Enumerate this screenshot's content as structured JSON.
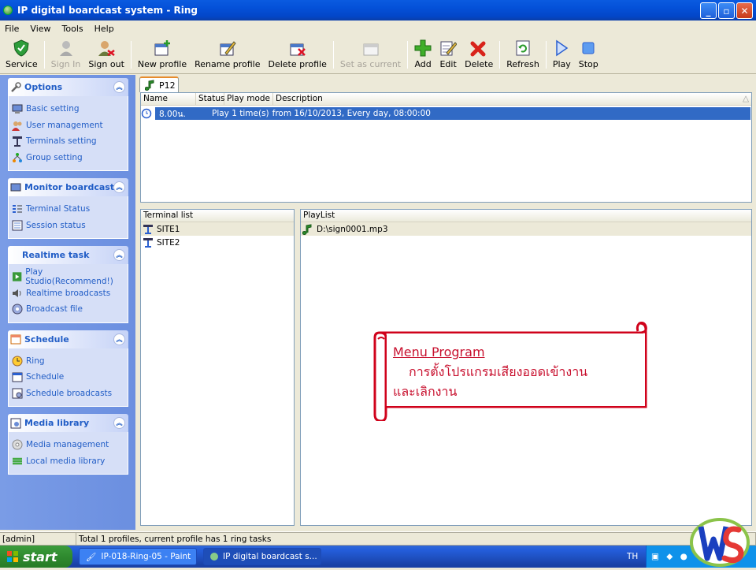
{
  "window": {
    "title": "IP digital boardcast system  -  Ring"
  },
  "menu": [
    "File",
    "View",
    "Tools",
    "Help"
  ],
  "toolbar": [
    {
      "label": "Service",
      "icon": "shield-icon",
      "disabled": false
    },
    {
      "label": "Sign In",
      "icon": "user-icon",
      "disabled": true
    },
    {
      "label": "Sign out",
      "icon": "user-signout-icon",
      "disabled": false
    },
    {
      "label": "New profile",
      "icon": "new-profile-icon",
      "disabled": false
    },
    {
      "label": "Rename profile",
      "icon": "rename-profile-icon",
      "disabled": false
    },
    {
      "label": "Delete profile",
      "icon": "delete-profile-icon",
      "disabled": false
    },
    {
      "label": "Set as current",
      "icon": "set-current-icon",
      "disabled": true
    },
    {
      "label": "Add",
      "icon": "add-icon",
      "disabled": false
    },
    {
      "label": "Edit",
      "icon": "edit-icon",
      "disabled": false
    },
    {
      "label": "Delete",
      "icon": "delete-icon",
      "disabled": false
    },
    {
      "label": "Refresh",
      "icon": "refresh-icon",
      "disabled": false
    },
    {
      "label": "Play",
      "icon": "play-icon",
      "disabled": false
    },
    {
      "label": "Stop",
      "icon": "stop-icon",
      "disabled": false
    }
  ],
  "sidebar": {
    "groups": [
      {
        "title": "Options",
        "items": [
          "Basic setting",
          "User management",
          "Terminals setting",
          "Group setting"
        ]
      },
      {
        "title": "Monitor boardcast",
        "items": [
          "Terminal Status",
          "Session status"
        ]
      },
      {
        "title": "Realtime task",
        "items": [
          "Play Studio(Recommend!)",
          "Realtime broadcasts",
          "Broadcast file"
        ]
      },
      {
        "title": "Schedule",
        "items": [
          "Ring",
          "Schedule",
          "Schedule broadcasts"
        ]
      },
      {
        "title": "Media library",
        "items": [
          "Media management",
          "Local media library"
        ]
      }
    ]
  },
  "tabs": [
    {
      "label": "P12"
    }
  ],
  "profiles_table": {
    "columns": [
      "Name",
      "Status",
      "Play mode",
      "Description"
    ],
    "rows": [
      {
        "name": "8.00น.",
        "status": "",
        "play_mode": "Play 1 time(s)",
        "description": "from 16/10/2013, Every day, 08:00:00"
      }
    ]
  },
  "terminal_list": {
    "header": "Terminal list",
    "items": [
      "SITE1",
      "SITE2"
    ]
  },
  "playlist": {
    "header": "PlayList",
    "items": [
      "D:\\sign0001.mp3"
    ]
  },
  "statusbar": {
    "user": "[admin]",
    "message": "Total 1 profiles, current profile has 1 ring tasks"
  },
  "taskbar": {
    "start": "start",
    "tasks": [
      "IP-018-Ring-05 - Paint",
      "IP digital boardcast s..."
    ],
    "lang": "TH"
  },
  "callout": {
    "title": "Menu Program",
    "line1": "การตั้งโปรแกรมเสียงออดเข้างาน",
    "line2": "และเลิกงาน"
  },
  "colors": {
    "accent": "#215dc6",
    "selection": "#316ac5",
    "callout": "#c8102e"
  }
}
